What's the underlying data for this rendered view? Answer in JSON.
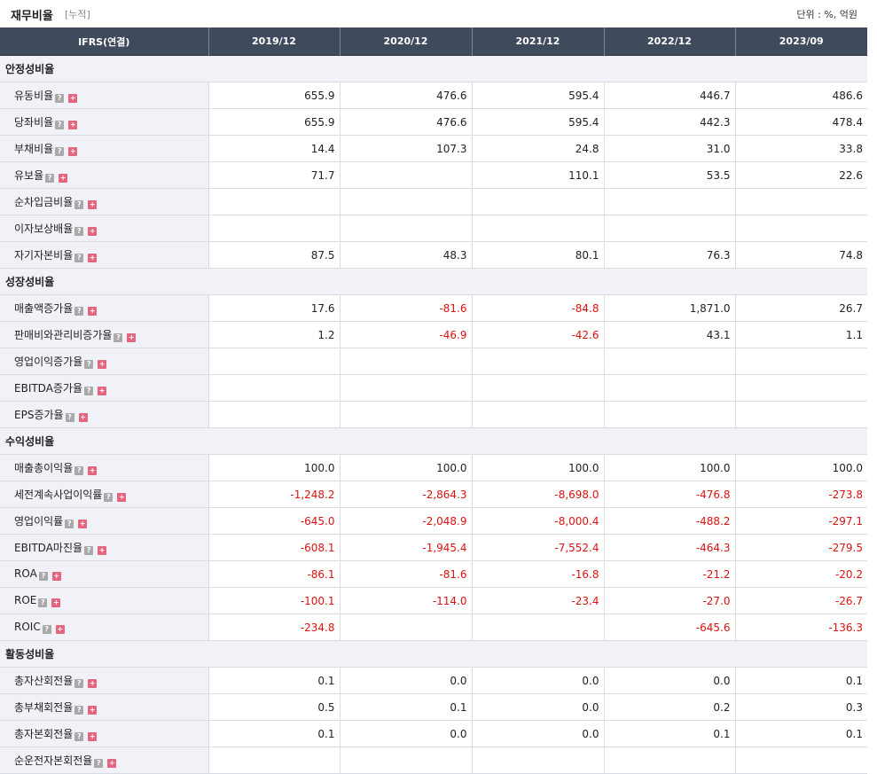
{
  "header": {
    "title": "재무비율",
    "subtitle": "[누적]",
    "unit": "단위 : %, 억원"
  },
  "columns": [
    "IFRS(연결)",
    "2019/12",
    "2020/12",
    "2021/12",
    "2022/12",
    "2023/09"
  ],
  "icons": {
    "help": "question-icon",
    "expand": "plus-icon",
    "help_glyph": "?",
    "expand_glyph": "+"
  },
  "colors": {
    "header_bg": "#3f4a5c",
    "negative": "#dd1111",
    "expand": "#e5647e"
  },
  "sections": [
    {
      "title": "안정성비율",
      "rows": [
        {
          "label": "유동비율",
          "values": [
            "655.9",
            "476.6",
            "595.4",
            "446.7",
            "486.6"
          ]
        },
        {
          "label": "당좌비율",
          "values": [
            "655.9",
            "476.6",
            "595.4",
            "442.3",
            "478.4"
          ]
        },
        {
          "label": "부채비율",
          "values": [
            "14.4",
            "107.3",
            "24.8",
            "31.0",
            "33.8"
          ]
        },
        {
          "label": "유보율",
          "values": [
            "71.7",
            "",
            "110.1",
            "53.5",
            "22.6"
          ]
        },
        {
          "label": "순차입금비율",
          "values": [
            "",
            "",
            "",
            "",
            ""
          ]
        },
        {
          "label": "이자보상배율",
          "values": [
            "",
            "",
            "",
            "",
            ""
          ]
        },
        {
          "label": "자기자본비율",
          "values": [
            "87.5",
            "48.3",
            "80.1",
            "76.3",
            "74.8"
          ]
        }
      ]
    },
    {
      "title": "성장성비율",
      "rows": [
        {
          "label": "매출액증가율",
          "values": [
            "17.6",
            "-81.6",
            "-84.8",
            "1,871.0",
            "26.7"
          ]
        },
        {
          "label": "판매비와관리비증가율",
          "values": [
            "1.2",
            "-46.9",
            "-42.6",
            "43.1",
            "1.1"
          ]
        },
        {
          "label": "영업이익증가율",
          "values": [
            "",
            "",
            "",
            "",
            ""
          ]
        },
        {
          "label": "EBITDA증가율",
          "values": [
            "",
            "",
            "",
            "",
            ""
          ]
        },
        {
          "label": "EPS증가율",
          "values": [
            "",
            "",
            "",
            "",
            ""
          ]
        }
      ]
    },
    {
      "title": "수익성비율",
      "rows": [
        {
          "label": "매출총이익율",
          "values": [
            "100.0",
            "100.0",
            "100.0",
            "100.0",
            "100.0"
          ]
        },
        {
          "label": "세전계속사업이익률",
          "values": [
            "-1,248.2",
            "-2,864.3",
            "-8,698.0",
            "-476.8",
            "-273.8"
          ]
        },
        {
          "label": "영업이익률",
          "values": [
            "-645.0",
            "-2,048.9",
            "-8,000.4",
            "-488.2",
            "-297.1"
          ]
        },
        {
          "label": "EBITDA마진율",
          "values": [
            "-608.1",
            "-1,945.4",
            "-7,552.4",
            "-464.3",
            "-279.5"
          ]
        },
        {
          "label": "ROA",
          "values": [
            "-86.1",
            "-81.6",
            "-16.8",
            "-21.2",
            "-20.2"
          ]
        },
        {
          "label": "ROE",
          "values": [
            "-100.1",
            "-114.0",
            "-23.4",
            "-27.0",
            "-26.7"
          ]
        },
        {
          "label": "ROIC",
          "values": [
            "-234.8",
            "",
            "",
            "-645.6",
            "-136.3"
          ]
        }
      ]
    },
    {
      "title": "활동성비율",
      "rows": [
        {
          "label": "총자산회전율",
          "values": [
            "0.1",
            "0.0",
            "0.0",
            "0.0",
            "0.1"
          ]
        },
        {
          "label": "총부채회전율",
          "values": [
            "0.5",
            "0.1",
            "0.0",
            "0.2",
            "0.3"
          ]
        },
        {
          "label": "총자본회전율",
          "values": [
            "0.1",
            "0.0",
            "0.0",
            "0.1",
            "0.1"
          ]
        },
        {
          "label": "순운전자본회전율",
          "values": [
            "",
            "",
            "",
            "",
            ""
          ]
        }
      ]
    }
  ]
}
